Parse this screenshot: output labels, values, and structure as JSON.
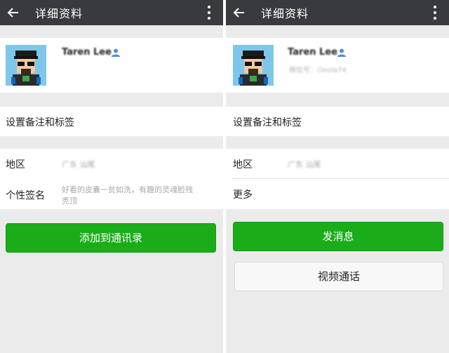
{
  "left": {
    "title": "详细资料",
    "profile_name": "Taren Lee",
    "remark_label": "设置备注和标签",
    "region_label": "地区",
    "region_value": "广东 汕尾",
    "signature_label": "个性签名",
    "signature_line1": "好看的皮囊一贫如洗，有趣的灵魂脸残",
    "signature_line2": "秃顶",
    "add_button": "添加到通讯录"
  },
  "right": {
    "title": "详细资料",
    "profile_name": "Taren Lee",
    "wechat_id": "微信号：Oeola74",
    "remark_label": "设置备注和标签",
    "region_label": "地区",
    "region_value": "广东 汕尾",
    "more_label": "更多",
    "message_button": "发消息",
    "video_button": "视频通话"
  },
  "colors": {
    "topbar": "#393a3f",
    "accent_green": "#1aad19",
    "background": "#ebebeb",
    "contact_icon": "#4a90d9"
  },
  "icons": [
    "back-arrow-icon",
    "more-vertical-icon",
    "person-icon",
    "avatar"
  ]
}
